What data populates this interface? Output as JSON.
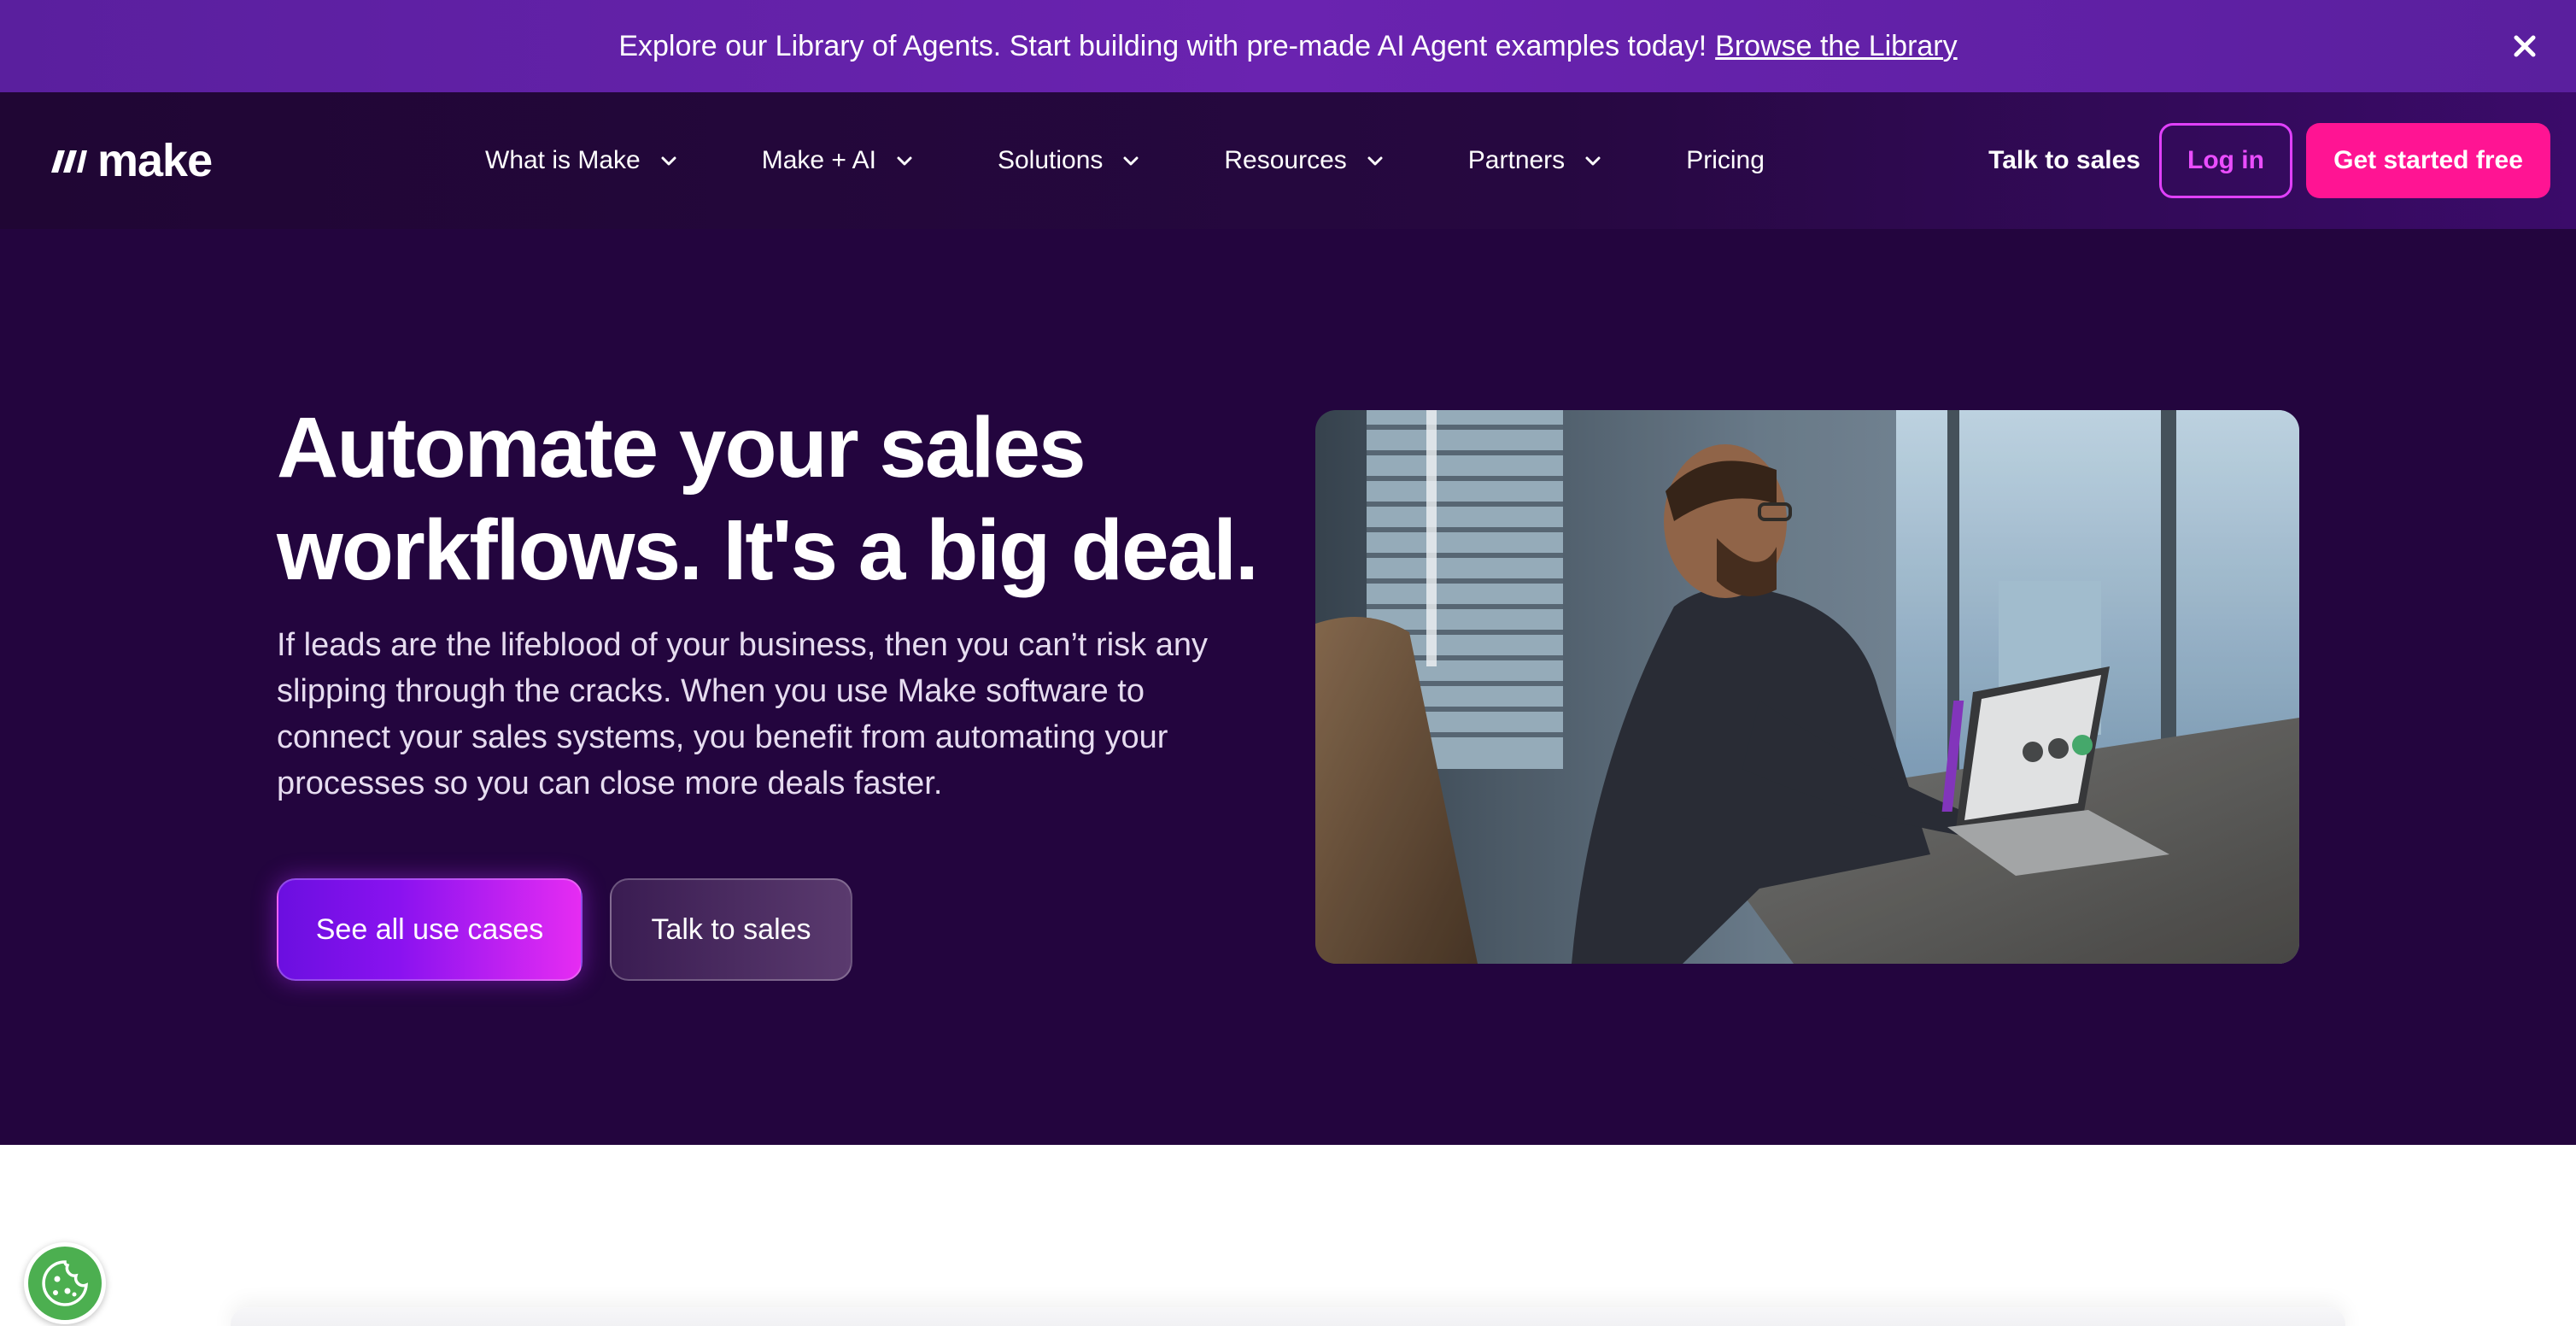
{
  "announcement": {
    "text": "Explore our Library of Agents. Start building with pre-made AI Agent examples today!",
    "link_label": "Browse the Library",
    "close_icon": "close-icon"
  },
  "header": {
    "logo_text": "make",
    "nav": [
      {
        "label": "What is Make",
        "has_dropdown": true
      },
      {
        "label": "Make + AI",
        "has_dropdown": true
      },
      {
        "label": "Solutions",
        "has_dropdown": true
      },
      {
        "label": "Resources",
        "has_dropdown": true
      },
      {
        "label": "Partners",
        "has_dropdown": true
      },
      {
        "label": "Pricing",
        "has_dropdown": false
      }
    ],
    "talk_to_sales": "Talk to sales",
    "login": "Log in",
    "get_started": "Get started free"
  },
  "hero": {
    "title_line1": "Automate your sales",
    "title_line2": "workflows. It's a big deal.",
    "description": "If leads are the lifeblood of your business, then you can’t risk any slipping through the cracks. When you use Make software to connect your sales systems, you benefit from automating your processes so you can close more deals faster.",
    "primary_button": "See all use cases",
    "secondary_button": "Talk to sales",
    "image_icon": "office-worker-laptop-photo"
  },
  "cookie_icon": "cookie-icon",
  "colors": {
    "announcement_bg": "#6a23b0",
    "header_bg": "#260840",
    "hero_bg": "#23053e",
    "accent_pink": "#ff1493",
    "login_border": "#e040fb"
  }
}
